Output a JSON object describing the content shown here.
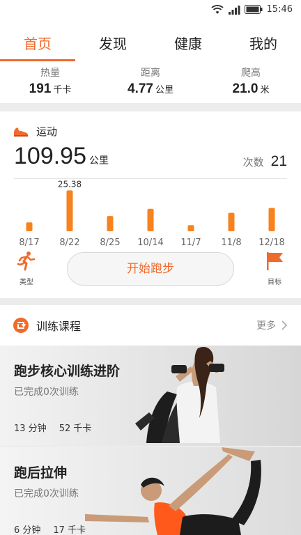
{
  "status_bar": {
    "time": "15:46"
  },
  "tabs": [
    {
      "label": "首页",
      "active": true
    },
    {
      "label": "发现",
      "active": false
    },
    {
      "label": "健康",
      "active": false
    },
    {
      "label": "我的",
      "active": false
    }
  ],
  "stats": [
    {
      "label": "热量",
      "value": "191",
      "unit": "千卡"
    },
    {
      "label": "距离",
      "value": "4.77",
      "unit": "公里"
    },
    {
      "label": "爬高",
      "value": "21.0",
      "unit": "米"
    }
  ],
  "sport": {
    "icon": "running-shoe-icon",
    "title": "运动",
    "distance": "109.95",
    "distance_unit": "公里",
    "count_label": "次数",
    "count_value": "21",
    "type_label": "类型",
    "start_label": "开始跑步",
    "goal_label": "目标"
  },
  "chart_data": {
    "type": "bar",
    "categories": [
      "8/17",
      "8/22",
      "8/25",
      "10/14",
      "11/7",
      "11/8",
      "12/18"
    ],
    "values": [
      5.5,
      25.38,
      9.5,
      14.0,
      3.8,
      11.5,
      14.5
    ],
    "annotations": [
      {
        "category": "8/22",
        "text": "25.38"
      }
    ],
    "ylim": [
      0,
      26
    ]
  },
  "training": {
    "title": "训练课程",
    "more": "更多"
  },
  "courses": [
    {
      "title": "跑步核心训练进阶",
      "subtitle": "已完成0次训练",
      "duration": "13 分钟",
      "calories": "52 千卡"
    },
    {
      "title": "跑后拉伸",
      "subtitle": "已完成0次训练",
      "duration": "6 分钟",
      "calories": "17 千卡"
    }
  ],
  "colors": {
    "accent": "#f06a2b",
    "bar": "#f7821e"
  }
}
